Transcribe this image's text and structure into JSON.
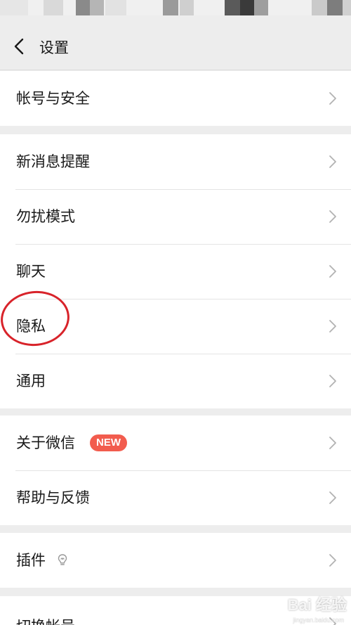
{
  "header": {
    "title": "设置",
    "back_icon": "chevron-left-icon"
  },
  "groups": [
    {
      "items": [
        {
          "label": "帐号与安全"
        }
      ]
    },
    {
      "items": [
        {
          "label": "新消息提醒"
        },
        {
          "label": "勿扰模式"
        },
        {
          "label": "聊天"
        },
        {
          "label": "隐私"
        },
        {
          "label": "通用"
        }
      ]
    },
    {
      "items": [
        {
          "label": "关于微信",
          "badge": "NEW"
        },
        {
          "label": "帮助与反馈"
        }
      ]
    },
    {
      "items": [
        {
          "label": "插件",
          "icon": "lightbulb-icon"
        }
      ]
    },
    {
      "items": [
        {
          "label": "切换帐号"
        }
      ]
    }
  ],
  "watermark": {
    "text": "Bai 经验",
    "sub": "jingyan.baidu.com"
  },
  "colors": {
    "background": "#ededed",
    "row_background": "#ffffff",
    "badge": "#f25c4e",
    "annotation": "#d8232a"
  }
}
